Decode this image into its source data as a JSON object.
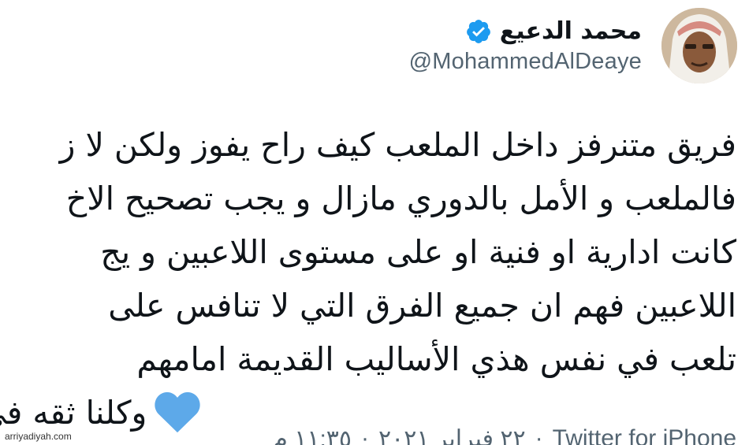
{
  "tweet": {
    "display_name": "محمد الدعيع",
    "handle": "@MohammedAlDeaye",
    "text_lines": [
      "فريق متنرفز داخل الملعب كيف راح يفوز ولكن لا ز",
      "فالملعب و الأمل بالدوري مازال و يجب تصحيح الاخ",
      "كانت ادارية او فنية او على مستوى اللاعبين و يج",
      "اللاعبين فهم ان جميع الفرق التي لا تنافس على",
      "تلعب في نفس هذي الأساليب القديمة امامهم",
      "وكلنا ثقه في زعيم آسيا"
    ],
    "time": "١١:٣٥ م",
    "date": "٢٢ فبراير ٢٠٢١",
    "separator": "·",
    "source": "Twitter for iPhone"
  },
  "watermark": "arriyadiyah.com",
  "colors": {
    "verified": "#1d9bf0",
    "heart": "#5da9e9",
    "text": "#0f1419",
    "secondary": "#536471"
  },
  "icons": {
    "verified": "verified-badge-icon",
    "heart": "blue-heart-icon"
  }
}
